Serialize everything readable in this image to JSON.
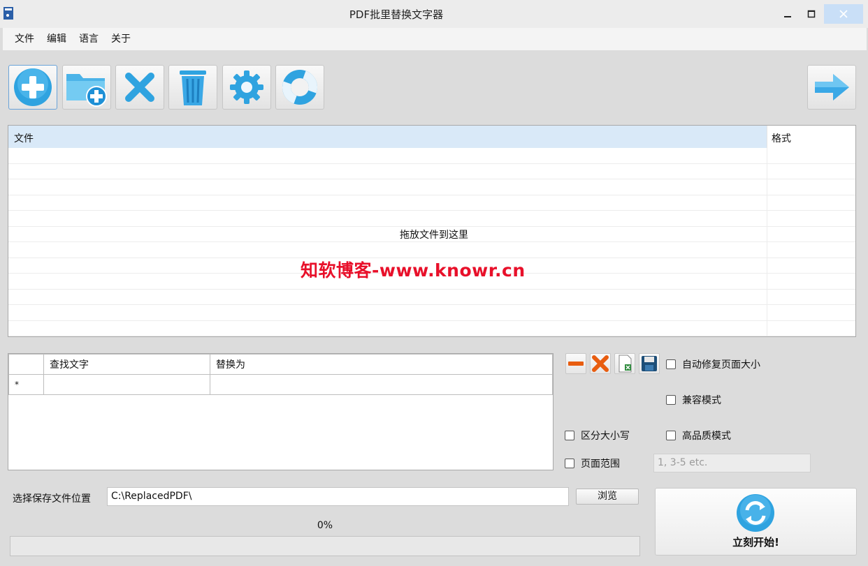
{
  "window": {
    "title": "PDF批里替换文字器"
  },
  "menu": [
    "文件",
    "编辑",
    "语言",
    "关于"
  ],
  "toolbar": {
    "buttons": [
      "add-file",
      "add-folder",
      "remove",
      "clear",
      "settings",
      "help"
    ],
    "next": "next"
  },
  "filelist": {
    "col_file": "文件",
    "col_format": "格式",
    "drop_hint": "拖放文件到这里",
    "watermark": "知软博客-www.knowr.cn"
  },
  "replace_grid": {
    "col_find": "查找文字",
    "col_replace": "替换为",
    "new_row_marker": "*"
  },
  "options": {
    "auto_fix_page_size": "自动修复页面大小",
    "compat_mode": "兼容模式",
    "case_sensitive": "区分大小写",
    "high_quality": "高品质模式",
    "page_range": "页面范围",
    "page_range_placeholder": "1, 3-5 etc."
  },
  "save": {
    "label": "选择保存文件位置",
    "path": "C:\\ReplacedPDF\\",
    "browse": "浏览"
  },
  "progress": {
    "percent_text": "0%",
    "value": 0
  },
  "start": {
    "label": "立刻开始!"
  },
  "colors": {
    "accent_blue": "#3aa8e6",
    "watermark_red": "#e8102a"
  }
}
